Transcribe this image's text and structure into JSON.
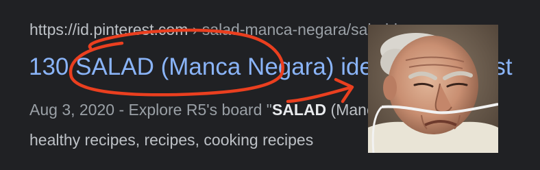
{
  "result": {
    "url": {
      "domain": "https://id.pinterest.com",
      "separator": " › ",
      "path": "salad-manca-negara/salad-in..."
    },
    "title": "130 SALAD (Manca Negara) ideas | Pinterest",
    "snippet": {
      "line1_prefix": "Aug 3, 2020 - Explore R5's board \"",
      "line1_bold": "SALAD",
      "line1_suffix": " (Manca Negara)\" on",
      "line2": "healthy recipes, recipes, cooking recipes"
    }
  },
  "annotation": {
    "color": "#ea3f1f"
  },
  "reaction_image": {
    "subject": "elderly-man-scowling-with-nasal-cannula"
  }
}
